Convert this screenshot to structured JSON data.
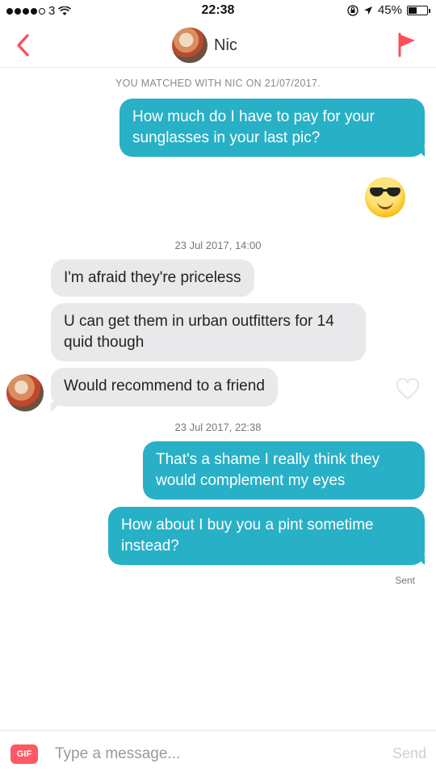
{
  "status_bar": {
    "carrier": "3",
    "time": "22:38",
    "battery_percent": "45%",
    "battery_level": 0.45,
    "signal_dots_filled": 4,
    "signal_dots_total": 5
  },
  "header": {
    "back_icon": "chevron-left-icon",
    "contact_name": "Nic",
    "flag_icon": "flag-icon",
    "accent_color": "#ff4f5a"
  },
  "conversation": {
    "match_banner": "YOU MATCHED WITH NIC ON 21/07/2017.",
    "msg1": "How much do I have to pay for your sunglasses in your last pic?",
    "emoji": "smiling-face-with-sunglasses",
    "timestamp1": "23 Jul 2017, 14:00",
    "msg2": "I'm afraid they're priceless",
    "msg3": "U can get them in urban outfitters for 14 quid though",
    "msg4": "Would recommend to a friend",
    "timestamp2": "23 Jul 2017, 22:38",
    "msg5": "That's a shame I really think they would complement my eyes",
    "msg6": "How about I buy you a pint sometime instead?",
    "sent_status": "Sent",
    "outgoing_color": "#28b0c6",
    "incoming_color": "#e9e9eb"
  },
  "composer": {
    "gif_label": "GIF",
    "placeholder": "Type a message...",
    "send_label": "Send"
  }
}
